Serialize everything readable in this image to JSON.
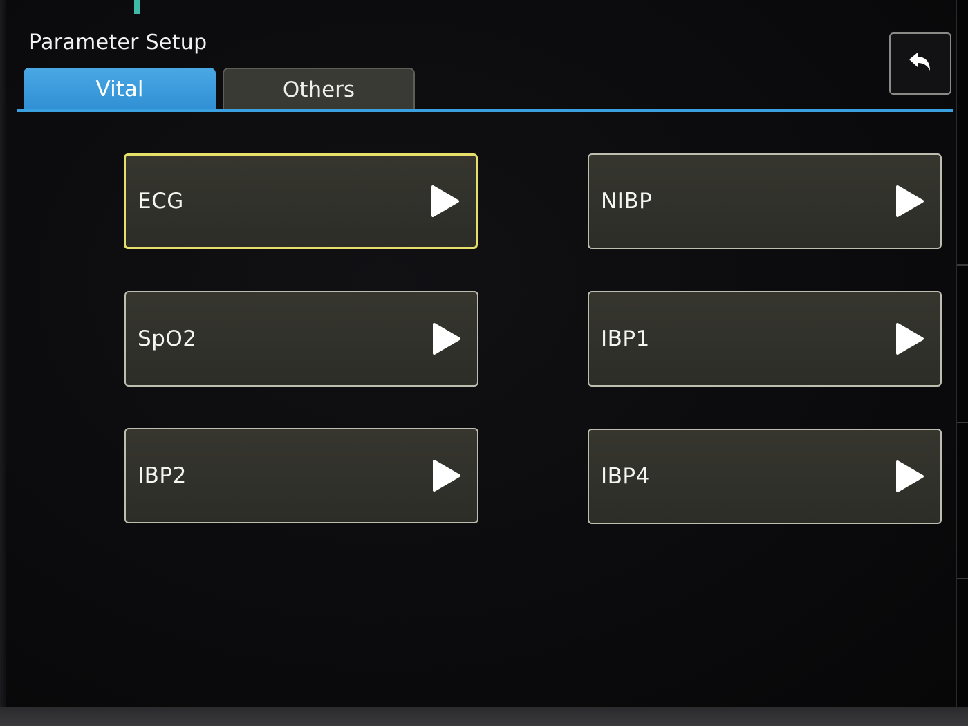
{
  "header": {
    "title": "Parameter Setup",
    "back_icon": "back-arrow-icon"
  },
  "tabs": [
    {
      "label": "Vital",
      "active": true
    },
    {
      "label": "Others",
      "active": false
    }
  ],
  "params": [
    {
      "label": "ECG",
      "selected": true
    },
    {
      "label": "NIBP",
      "selected": false
    },
    {
      "label": "SpO2",
      "selected": false
    },
    {
      "label": "IBP1",
      "selected": false
    },
    {
      "label": "IBP2",
      "selected": false
    },
    {
      "label": "IBP4",
      "selected": false
    }
  ],
  "colors": {
    "active_tab": "#2f8fd3",
    "selected_border": "#e6e06a",
    "button_bg": "#33332d"
  }
}
